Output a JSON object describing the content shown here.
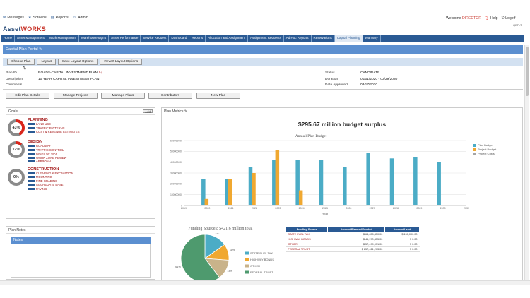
{
  "toplinks": [
    {
      "icon": "mail-icon",
      "label": "Messages"
    },
    {
      "icon": "star-icon",
      "label": "Screens"
    },
    {
      "icon": "report-icon",
      "label": "Reports"
    },
    {
      "icon": "person-icon",
      "label": "Admin"
    }
  ],
  "logo": {
    "part1": "Asset",
    "part2": "WORKS"
  },
  "header": {
    "welcome": "Welcome",
    "user": "DIRECTOR",
    "help": "Help",
    "logoff": "Logoff",
    "extra": "QEFLT"
  },
  "nav": [
    "Home",
    "Asset Management",
    "Work Management",
    "Warehouse Mgmt",
    "Asset Performance",
    "Service Request",
    "Dashboard",
    "Reports",
    "Allocation and Assignment",
    "Assignment Requests",
    "Ad Hoc Reports",
    "Reservations",
    "Capital Planning",
    "Warranty"
  ],
  "portal": {
    "title": "Capital Plan Portal"
  },
  "toolbar": [
    "Choose Plan",
    "Layout",
    "Save Layout Options",
    "Revert Layout Options"
  ],
  "plan": {
    "id_label": "Plan ID",
    "id": "ROADS-CAPITAL INVESTMENT PLAN",
    "desc_label": "Description",
    "desc": "10 YEAR CAPITAL INVESTMENT PLAN",
    "comments_label": "Comments",
    "status_label": "Status",
    "status": "CANDIDATE",
    "duration_label": "Duration",
    "duration": "01/01/2020 - 03/29/2030",
    "approved_label": "Date Approved",
    "approved": "03/17/2020"
  },
  "actions": [
    "Edit Plan Details",
    "Manage Projects",
    "Manage Plans",
    "Contributors",
    "New Plan"
  ],
  "goals": {
    "title": "Goals",
    "add": "Add",
    "items": [
      {
        "name": "PLANNING",
        "pct": "43%",
        "value": 43,
        "color": "#d9261c",
        "subs": [
          "LAND USE",
          "TRAFFIC PATTERNS",
          "COST & REVENUE ESTIMATES"
        ]
      },
      {
        "name": "DESIGN",
        "pct": "12%",
        "value": 12,
        "color": "#d9261c",
        "subs": [
          "ROADWAY",
          "TRAFFIC CONTROL",
          "RIGHT OF WAY",
          "WORK ZONE REVIEW",
          "APPROVAL"
        ]
      },
      {
        "name": "CONSTRUCTION",
        "pct": "0%",
        "value": 0,
        "color": "#d9261c",
        "subs": [
          "CLEARING & EXCAVATION",
          "MOUNTING",
          "FINE GRADING",
          "AGGREGATE BASE",
          "PAVING"
        ]
      }
    ]
  },
  "notes": {
    "title": "Plan Notes",
    "bar": "Notes"
  },
  "metrics": {
    "title": "Plan Metrics",
    "headline": "$295.67 million budget surplus"
  },
  "funding": {
    "title": "Funding Sources: $421.6 million total",
    "headers": [
      "Funding Source",
      "Amount Planned/Funded",
      "Amount Used"
    ],
    "rows": [
      [
        "STATE FUEL TAX",
        "$ 64,655,450.00",
        "$ 150,000.00"
      ],
      [
        "HIGHWAY BONDS",
        "$ 46,970,455.00",
        "$ 0.00"
      ],
      [
        "OTHER",
        "$ 57,499,931.00",
        "$ 0.00"
      ],
      [
        "FEDERAL TRUST",
        "$ 257,421,203.00",
        "$ 0.00"
      ]
    ]
  },
  "chart_data": [
    {
      "type": "bar",
      "title": "Annual Plan Budget",
      "xlabel": "Year",
      "ylabel": "",
      "categories": [
        "2019",
        "2020",
        "2021",
        "2022",
        "2023",
        "2024",
        "2025",
        "2026",
        "2027",
        "2028",
        "2029",
        "2030",
        "2031"
      ],
      "ylim": [
        0,
        600000000
      ],
      "ytick_labels": [
        "0",
        "100000000",
        "200000000",
        "300000000",
        "400000000",
        "500000000",
        "600000000"
      ],
      "legend": "right",
      "series": [
        {
          "name": "Plan Budget",
          "color": "#4bacc6",
          "values": [
            0,
            245000000,
            245000000,
            355000000,
            420000000,
            420000000,
            420000000,
            355000000,
            485000000,
            435000000,
            445000000,
            400000000,
            0
          ]
        },
        {
          "name": "Project Budget",
          "color": "#f0a830",
          "values": [
            0,
            60000000,
            245000000,
            300000000,
            515000000,
            140000000,
            0,
            0,
            0,
            0,
            0,
            0,
            0
          ]
        },
        {
          "name": "Project Costs",
          "color": "#a5a5a5",
          "values": [
            0,
            0,
            0,
            0,
            0,
            0,
            0,
            0,
            0,
            0,
            0,
            0,
            0
          ]
        }
      ]
    },
    {
      "type": "pie",
      "title": "Funding Sources: $421.6 million total",
      "legend": "right",
      "categories": [
        "STATE FUEL TAX",
        "HIGHWAY BONDS",
        "OTHER",
        "FEDERAL TRUST"
      ],
      "values": [
        64.66,
        46.97,
        57.5,
        257.42
      ],
      "labels": [
        "15%",
        "11%",
        "14%",
        "61%"
      ],
      "colors": [
        "#4bacc6",
        "#f0a830",
        "#c9b38a",
        "#4e9a6e"
      ]
    }
  ]
}
